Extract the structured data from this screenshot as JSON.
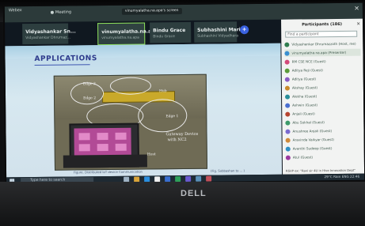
{
  "app": {
    "title": "Webex",
    "window_label": "Meeting",
    "share_label": "vinumyalatha.na.apa's screen"
  },
  "videos": [
    {
      "name": "Vidyashankar Sn...",
      "sub": "Vidyashankar Dhrumaz..."
    },
    {
      "name": "vinumyalatha.na.apa...",
      "sub": "vinumyalatha.na.apa",
      "active": true
    },
    {
      "name": "Bindu Grace",
      "sub": "Bindu Grace"
    },
    {
      "name": "Subhashini Mari...",
      "sub": "Subhashini Vidyadhara"
    }
  ],
  "slide": {
    "title": "APPLICATIONS",
    "labels": {
      "edge3": "Edge 3",
      "edge2": "Edge 2",
      "edge1": "Edge 1",
      "hub": "Hub",
      "gateway": "Gateway Device",
      "gateway2": "with NC2",
      "host": "Host"
    },
    "caption": "Figure. Distributed IoT device Communication",
    "caption_right": "(Fig. Subbashan to ... )"
  },
  "participants": {
    "title": "Participants (186)",
    "search_placeholder": "Find a participant",
    "rows": [
      {
        "name": "Vidyashankar Dhrumazzoth (Host, me)",
        "color": "#2f7d4f"
      },
      {
        "name": "vinumyalatha.na.apa (Presenter)",
        "color": "#3b8fd0",
        "highlight": true
      },
      {
        "name": "RM CSE NCE (Guest)",
        "color": "#d34a7a"
      },
      {
        "name": "Aditya Reji (Guest)",
        "color": "#5b9b3a"
      },
      {
        "name": "Aditya (Guest)",
        "color": "#8a5bc4"
      },
      {
        "name": "Akshay (Guest)",
        "color": "#c98a2a"
      },
      {
        "name": "Alekha (Guest)",
        "color": "#2a8f9b"
      },
      {
        "name": "Ashwin (Guest)",
        "color": "#4a6fd0"
      },
      {
        "name": "Anjali (Guest)",
        "color": "#b7442f"
      },
      {
        "name": "Abu Sokhal (Guest)",
        "color": "#3d9a6a"
      },
      {
        "name": "Anushree Anjali (Guest)",
        "color": "#7a6ad0"
      },
      {
        "name": "Aravinda Vaikyar (Guest)",
        "color": "#d08a3a"
      },
      {
        "name": "Avanthi Sudeep (Guest)",
        "color": "#2f8fc4"
      },
      {
        "name": "Atul (Guest)",
        "color": "#9b3aa0"
      }
    ],
    "footer": "RSVP ex: \"Ravi sir 4U in Hive Innovation Dept\""
  },
  "taskbar": {
    "search": "Type here to search",
    "tray": "29°C  Rain  ENG  22:46"
  },
  "brand": "DELL"
}
